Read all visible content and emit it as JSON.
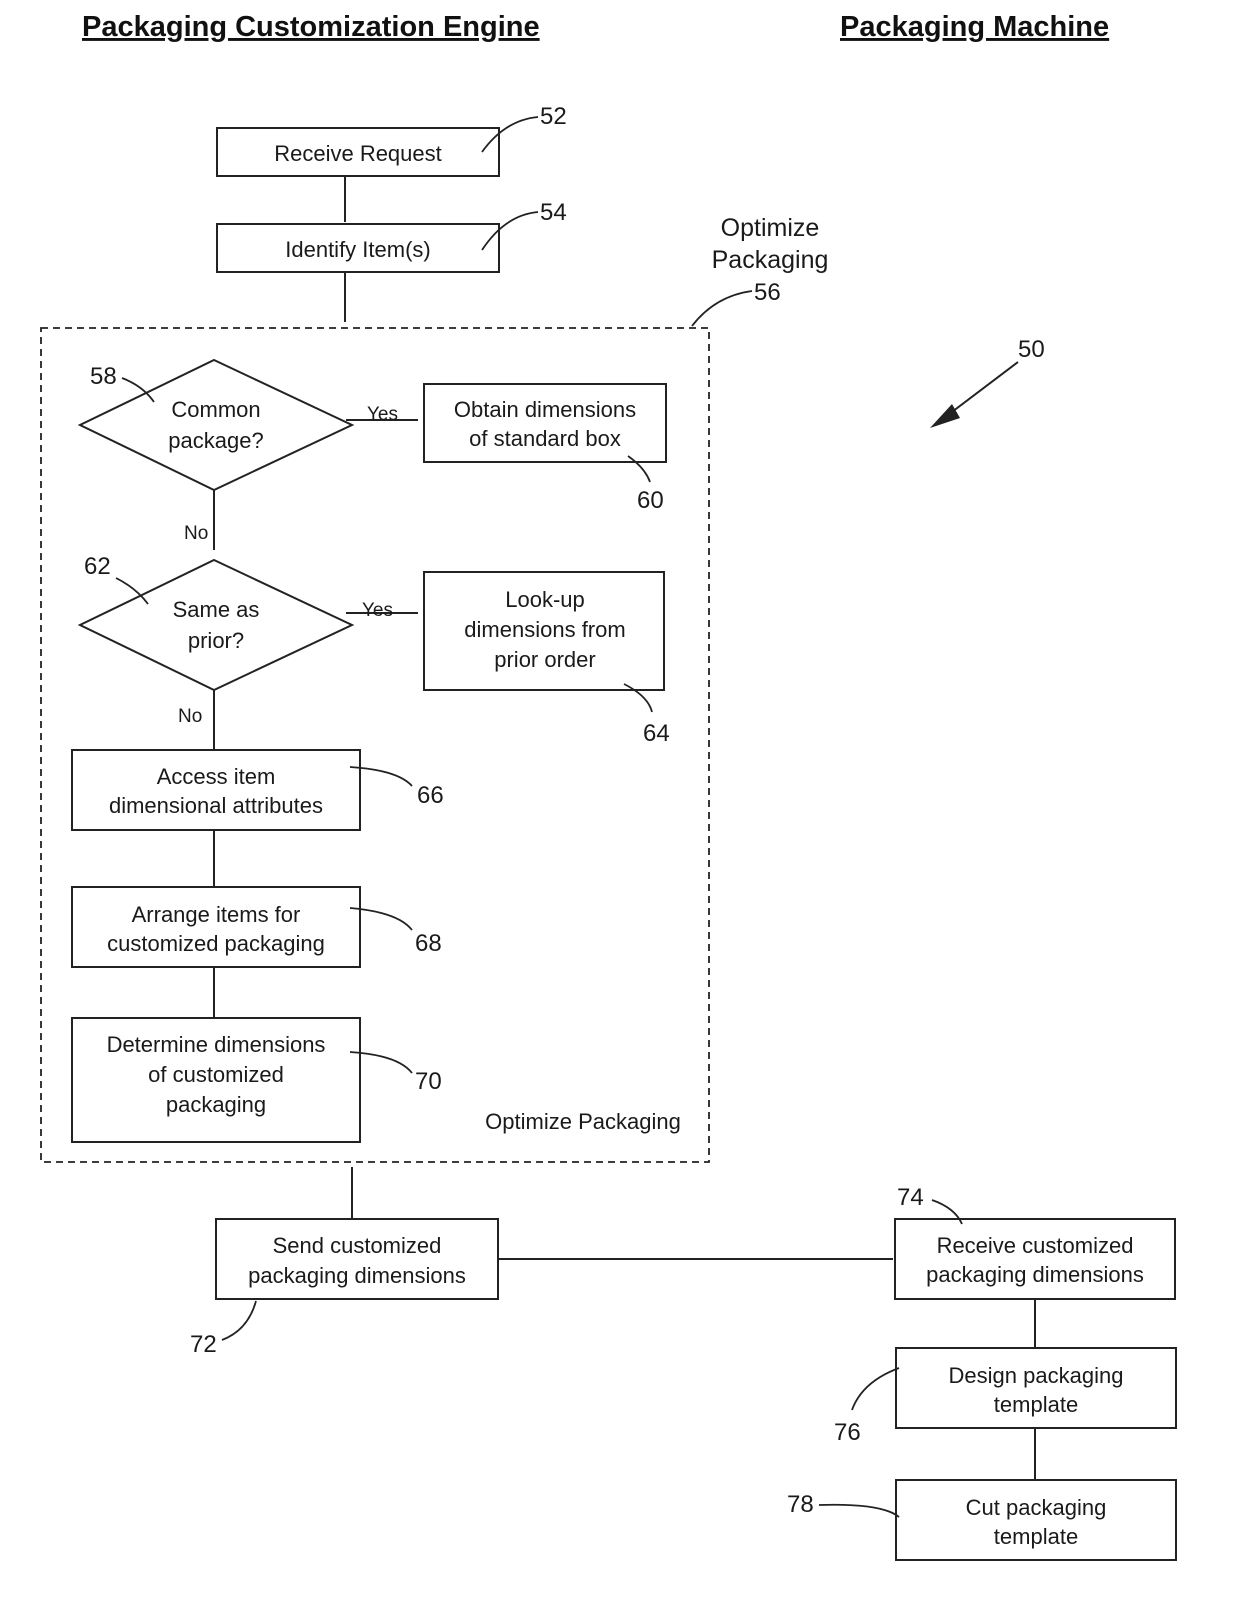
{
  "headings": {
    "left": "Packaging Customization Engine",
    "right": "Packaging Machine"
  },
  "figure_ref": "50",
  "group": {
    "title_line1": "Optimize",
    "title_line2": "Packaging",
    "ref": "56",
    "inner_label": "Optimize Packaging"
  },
  "steps": {
    "receive_request": {
      "lines": [
        "Receive Request"
      ],
      "ref": "52"
    },
    "identify_items": {
      "lines": [
        "Identify Item(s)"
      ],
      "ref": "54"
    },
    "common_package": {
      "lines": [
        "Common",
        "package?"
      ],
      "ref": "58"
    },
    "standard_box": {
      "lines": [
        "Obtain dimensions",
        "of standard box"
      ],
      "ref": "60"
    },
    "same_as_prior": {
      "lines": [
        "Same as",
        "prior?"
      ],
      "ref": "62"
    },
    "lookup_prior": {
      "lines": [
        "Look-up",
        "dimensions from",
        "prior order"
      ],
      "ref": "64"
    },
    "access_attributes": {
      "lines": [
        "Access item",
        "dimensional attributes"
      ],
      "ref": "66"
    },
    "arrange_items": {
      "lines": [
        "Arrange items for",
        "customized packaging"
      ],
      "ref": "68"
    },
    "determine_dimensions": {
      "lines": [
        "Determine dimensions",
        "of customized",
        "packaging"
      ],
      "ref": "70"
    },
    "send_dimensions": {
      "lines": [
        "Send customized",
        "packaging dimensions"
      ],
      "ref": "72"
    },
    "receive_dimensions": {
      "lines": [
        "Receive customized",
        "packaging dimensions"
      ],
      "ref": "74"
    },
    "design_template": {
      "lines": [
        "Design packaging",
        "template"
      ],
      "ref": "76"
    },
    "cut_template": {
      "lines": [
        "Cut packaging",
        "template"
      ],
      "ref": "78"
    }
  },
  "edge_labels": {
    "yes": "Yes",
    "no": "No"
  }
}
